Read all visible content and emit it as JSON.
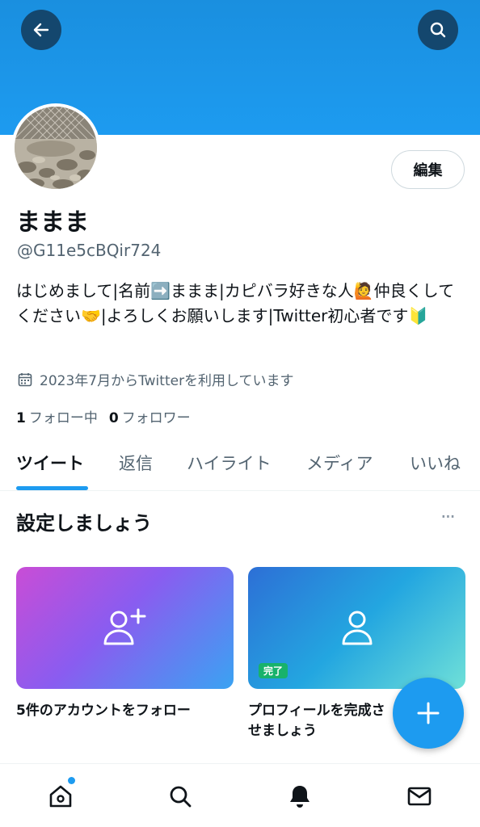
{
  "header": {
    "back_icon": "arrow-left-icon",
    "search_icon": "search-icon",
    "banner_color": "#1d9bf0"
  },
  "profile": {
    "display_name": "ままま",
    "handle": "@G11e5cBQir724",
    "edit_label": "編集",
    "bio": "はじめまして|名前➡️ままま|カピバラ好きな人🙋仲良くしてください🤝|よろしくお願いします|Twitter初心者です🔰",
    "joined": "2023年7月からTwitterを利用しています",
    "following_count": "1",
    "following_label": "フォロー中",
    "followers_count": "0",
    "followers_label": "フォロワー"
  },
  "tabs": [
    {
      "label": "ツイート",
      "active": true
    },
    {
      "label": "返信"
    },
    {
      "label": "ハイライト"
    },
    {
      "label": "メディア"
    },
    {
      "label": "いいね"
    }
  ],
  "setup": {
    "title": "設定しましょう",
    "more": "···",
    "cards": [
      {
        "caption": "5件のアカウントをフォロー",
        "icon": "person-add-icon"
      },
      {
        "caption": "プロフィールを完成させましょう",
        "icon": "person-icon",
        "badge": "完了"
      }
    ]
  },
  "bottom_nav": [
    "home-icon",
    "search-icon",
    "bell-icon",
    "mail-icon"
  ],
  "colors": {
    "accent": "#1d9bf0",
    "badge": "#18b26b"
  }
}
